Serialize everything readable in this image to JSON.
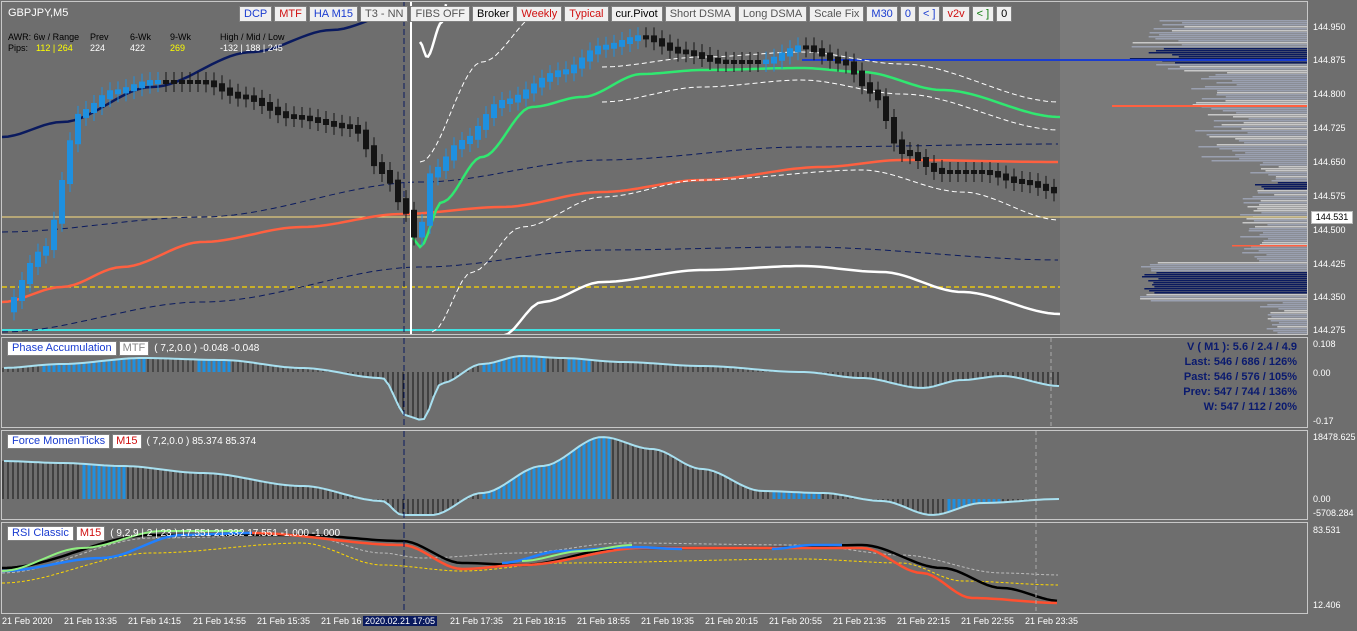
{
  "symbol": "GBPJPY,M5",
  "toolbar": [
    {
      "label": "DCP",
      "tone": "blue"
    },
    {
      "label": "MTF",
      "tone": "red"
    },
    {
      "label": "HA M15",
      "tone": "blue"
    },
    {
      "label": "T3 - NN",
      "tone": "grey"
    },
    {
      "label": "FIBS OFF",
      "tone": "grey"
    },
    {
      "label": "Broker",
      "tone": "dark"
    },
    {
      "label": "Weekly",
      "tone": "red"
    },
    {
      "label": "Typical",
      "tone": "red"
    },
    {
      "label": "cur.Pivot",
      "tone": "dark"
    },
    {
      "label": "Short DSMA",
      "tone": "grey"
    },
    {
      "label": "Long DSMA",
      "tone": "grey"
    },
    {
      "label": "Scale Fix",
      "tone": "grey"
    },
    {
      "label": "M30",
      "tone": "blue"
    },
    {
      "label": "0",
      "tone": "blue"
    },
    {
      "label": "< ]",
      "tone": "blue"
    },
    {
      "label": "v2v",
      "tone": "red"
    },
    {
      "label": "< ]",
      "tone": "green"
    },
    {
      "label": "0",
      "tone": "dark"
    }
  ],
  "stats": {
    "h_awr": "AWR: 6w / Range",
    "h_prev": "Prev",
    "h_6wk": "6-Wk",
    "h_9wk": "9-Wk",
    "h_hml": "High / Mid / Low",
    "pips_label": "Pips:",
    "pips_range": "112 | 264",
    "pips_prev": "224",
    "pips_6wk": "422",
    "pips_9wk": "269",
    "pips_hml": "-132 | 188 | 245"
  },
  "price_axis": [
    "144.950",
    "144.875",
    "144.800",
    "144.725",
    "144.650",
    "144.575",
    "144.500",
    "144.425",
    "144.350",
    "144.275"
  ],
  "current_price": "144.531",
  "indicators": {
    "phase": {
      "name": "Phase Accumulation",
      "tf": "MTF",
      "params": "( 7,2,0.0 ) -0.048 -0.048",
      "axis": [
        "0.108",
        "0.00",
        "-0.17"
      ]
    },
    "force": {
      "name": "Force MomenTicks",
      "tf": "M15",
      "params": "( 7,2,0.0 ) 85.374 85.374",
      "axis": [
        "18478.625",
        "0.00",
        "-5708.284"
      ]
    },
    "rsi": {
      "name": "RSI Classic",
      "tf": "M15",
      "params": "( 9,2,9 | 2 | 23 ) 17.551 21.332 17.551 -1.000 -1.000",
      "axis": [
        "83.531",
        "12.406"
      ]
    }
  },
  "volume_info": [
    "V ( M1 ): 5.6 / 2.4 / 4.9",
    "Last: 546 / 686 / 126%",
    "Past: 546 / 576 / 105%",
    "Prev: 547 / 744 / 136%",
    "W: 547 / 112 / 20%"
  ],
  "time_axis": [
    "21 Feb 2020",
    "21 Feb 13:35",
    "21 Feb 14:15",
    "21 Feb 14:55",
    "21 Feb 15:35",
    "21 Feb 16",
    "2020.02.21 17:05",
    "21 Feb 17:35",
    "21 Feb 18:15",
    "21 Feb 18:55",
    "21 Feb 19:35",
    "21 Feb 20:15",
    "21 Feb 20:55",
    "21 Feb 21:35",
    "21 Feb 22:15",
    "21 Feb 22:55",
    "21 Feb 23:35"
  ],
  "colors": {
    "bull": "#1e90e0",
    "bear": "#141414",
    "ema_fast": "#30e870",
    "ema_slow": "#ff6040",
    "ema_long": "#0a1a5e",
    "cur_line": "#ffe080",
    "cyan": "#40e0e0",
    "yellow_dash": "#ffd800"
  }
}
